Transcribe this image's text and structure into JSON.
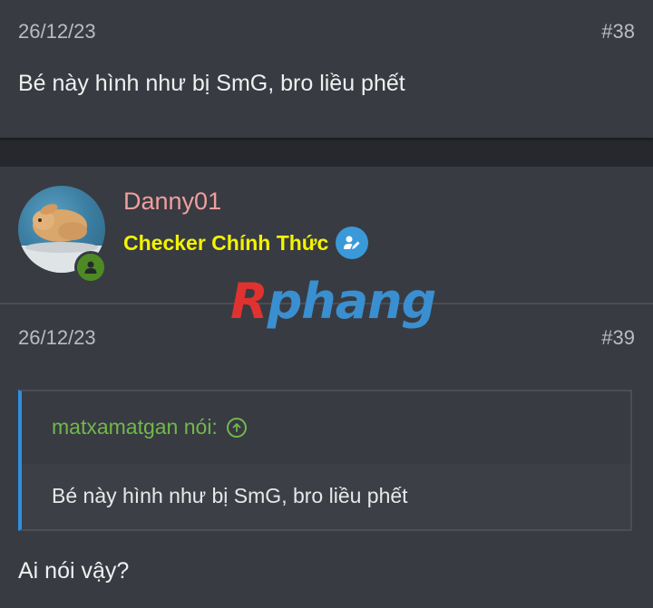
{
  "post_38": {
    "date": "26/12/23",
    "number": "#38",
    "message": "Bé này hình như bị SmG, bro liều phết"
  },
  "post_39": {
    "username": "Danny01",
    "user_title": "Checker Chính Thức",
    "date": "26/12/23",
    "number": "#39",
    "quote": {
      "author": "matxamatgan nói:",
      "text": "Bé này hình như bị SmG, bro liều phết"
    },
    "message": "Ai nói vậy?"
  },
  "watermark": {
    "r": "R",
    "rest": "phang"
  },
  "icons": {
    "avatar": "rabbit-photo",
    "online": "user-online-icon",
    "verified": "verified-edit-icon",
    "quote_jump": "arrow-up-circle-icon"
  },
  "colors": {
    "username": "#f19e9e",
    "user_title": "#f3f300",
    "quote_author": "#72b84a",
    "quote_border": "#2e8fe0",
    "online": "#4d8a23",
    "verified": "#3a9ad9"
  }
}
